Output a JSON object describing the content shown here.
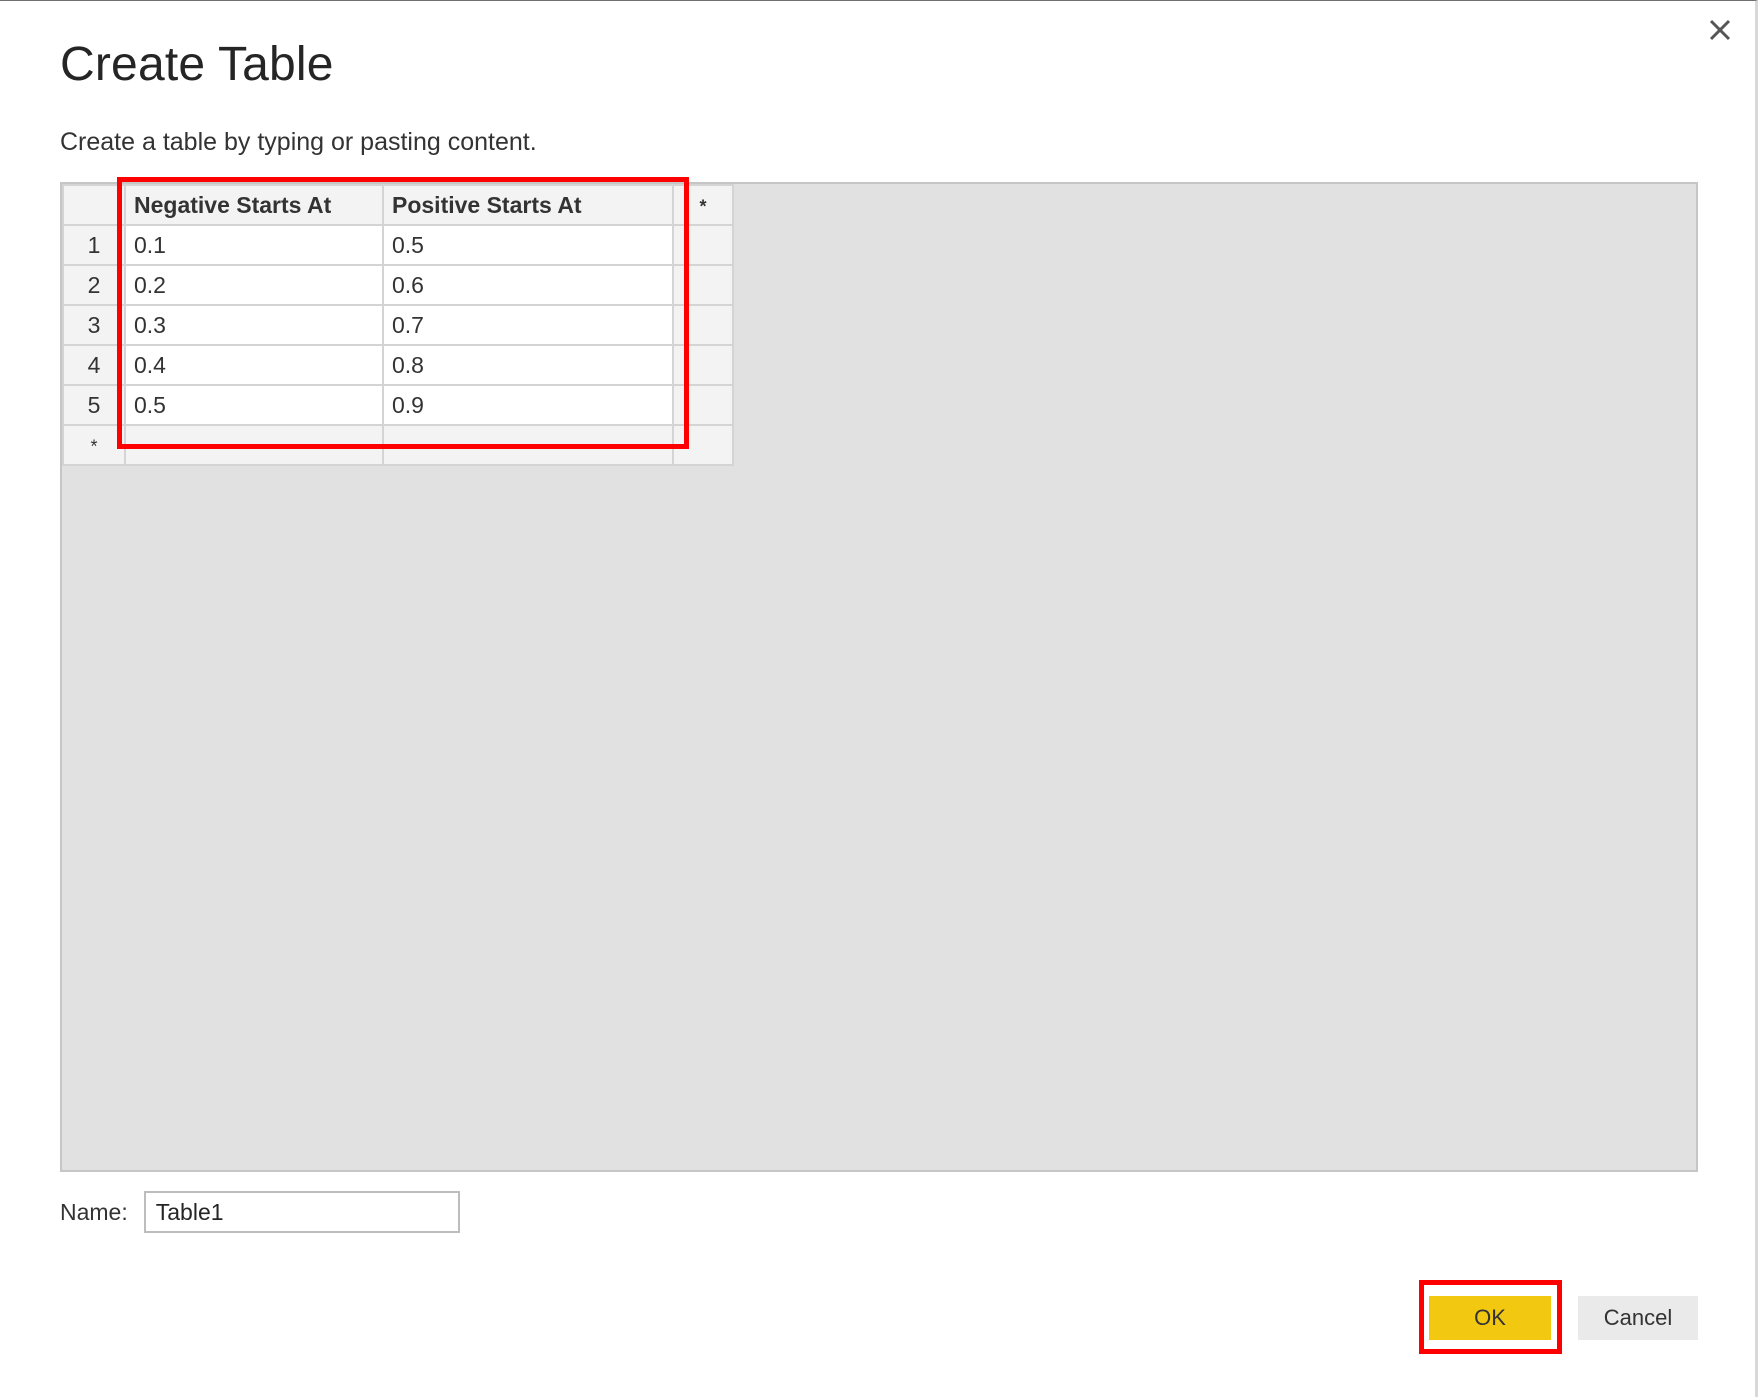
{
  "dialog": {
    "title": "Create Table",
    "subtitle": "Create a table by typing or pasting content.",
    "close_icon": "close-icon"
  },
  "table": {
    "columns": [
      "Negative Starts At",
      "Positive Starts At"
    ],
    "new_column_marker": "*",
    "new_row_marker": "*",
    "rows": [
      {
        "num": "1",
        "cells": [
          "0.1",
          "0.5"
        ]
      },
      {
        "num": "2",
        "cells": [
          "0.2",
          "0.6"
        ]
      },
      {
        "num": "3",
        "cells": [
          "0.3",
          "0.7"
        ]
      },
      {
        "num": "4",
        "cells": [
          "0.4",
          "0.8"
        ]
      },
      {
        "num": "5",
        "cells": [
          "0.5",
          "0.9"
        ]
      }
    ]
  },
  "name_field": {
    "label": "Name:",
    "value": "Table1"
  },
  "buttons": {
    "ok_label": "OK",
    "cancel_label": "Cancel"
  },
  "colors": {
    "ok_button": "#f2c811",
    "highlight": "#ff0000",
    "grid_background": "#e1e1e1"
  }
}
